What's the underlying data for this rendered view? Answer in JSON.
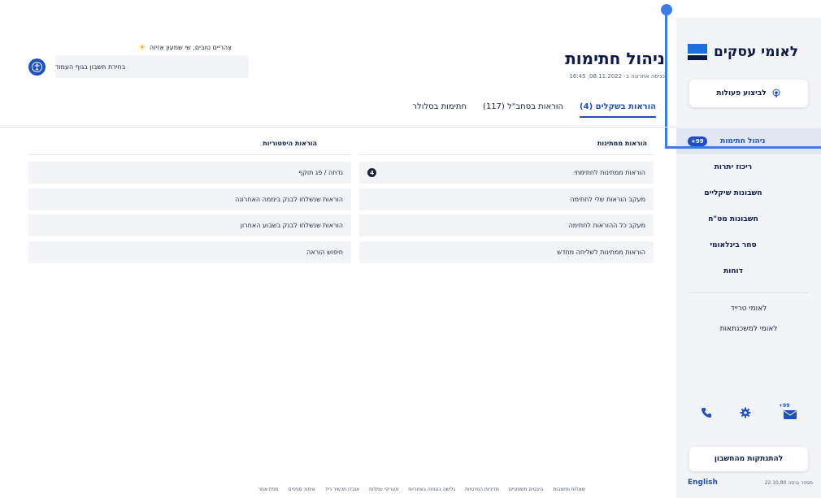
{
  "sidebar": {
    "logo_text": "לאומי עסקים",
    "action_button": "לביצוע פעולות",
    "nav_items": [
      {
        "label": "ניהול חתימות",
        "badge": "+99"
      },
      {
        "label": "ריכוז יתרות"
      },
      {
        "label": "חשבונות שיקליים"
      },
      {
        "label": "חשבונות מט\"ח"
      },
      {
        "label": "סחר בינלאומי"
      },
      {
        "label": "דוחות"
      }
    ],
    "sub_items": [
      "לאומי טרייד",
      "לאומי למשכנתאות"
    ],
    "messages_badge": "+99",
    "logout": "להתנתקות מהחשבון",
    "language": "English",
    "version": "מספר גרסה 22.10.80"
  },
  "header": {
    "title": "ניהול חתימות",
    "last_login": "כניסה אחרונה ב- 08.11.2022, 16:45",
    "greeting": "צהריים טובים, שי שמעון אזיזה",
    "account_select": "בחירת חשבון בגוף העמוד"
  },
  "tabs": [
    {
      "label": "הוראות בשקלים (4)",
      "active": true
    },
    {
      "label": "הוראות בסחב\"ל (117)"
    },
    {
      "label": "חתימות בסלולר"
    }
  ],
  "pending": {
    "title": "הוראות ממתינות",
    "rows": [
      {
        "label": "הוראות ממתינות לחתימתי",
        "count": "4"
      },
      {
        "label": "מעקב הוראות שלי לחתימה"
      },
      {
        "label": "מעקב כל ההוראות לחתימה"
      },
      {
        "label": "הוראות ממתינות לשליחה מחדש"
      }
    ]
  },
  "history": {
    "title": "הוראות היסטוריות",
    "rows": [
      {
        "label": "נדחה / פג תוקף"
      },
      {
        "label": "הוראות שנשלחו לבנק ביממה האחרונה"
      },
      {
        "label": "הוראות שנשלחו לבנק בשבוע האחרון"
      },
      {
        "label": "חיפוש הוראה"
      }
    ]
  },
  "footer_links": [
    "שאלות ותשובות",
    "היבטים משפטיים",
    "מדיניות הפרטיות",
    "גלישה בטוחה באחריות",
    "תעריפי עמלות",
    "אובדן מכשיר נייד",
    "איתור סניפים",
    "מפת אתר"
  ],
  "colors": {
    "accent": "#1d4fc4",
    "navy": "#0b1a4a",
    "sidebar_bg": "#f3f4f7",
    "highlight": "#3a7de8"
  }
}
